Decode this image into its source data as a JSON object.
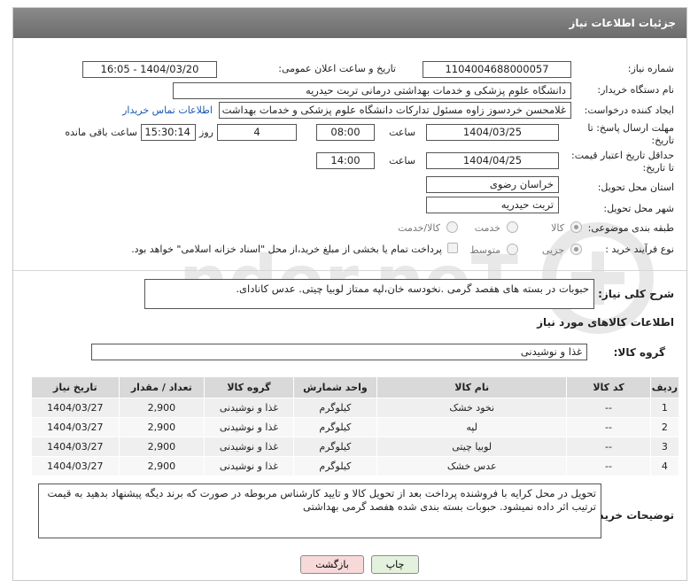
{
  "header": {
    "title": "جزئیات اطلاعات نیاز"
  },
  "fields": {
    "need_number_label": "شماره نیاز:",
    "need_number": "1104004688000057",
    "announce_label": "تاریخ و ساعت اعلان عمومی:",
    "announce_value": "1404/03/20 - 16:05",
    "buyer_org_label": "نام دستگاه خریدار:",
    "buyer_org": "دانشگاه علوم پزشکی و خدمات بهداشتی درمانی تربت حیدریه",
    "requester_label": "ایجاد کننده درخواست:",
    "requester": "غلامحسن خردسوز زاوه مسئول تدارکات دانشگاه علوم پزشکی و خدمات بهداشت",
    "contact_link": "اطلاعات تماس خریدار",
    "deadline_label": "مهلت ارسال پاسخ: تا تاریخ:",
    "deadline_date": "1404/03/25",
    "time_label": "ساعت",
    "deadline_time": "08:00",
    "days_value": "4",
    "days_label": "روز و",
    "remaining_time": "15:30:14",
    "remaining_label": "ساعت باقی مانده",
    "validity_label": "حداقل تاریخ اعتبار قیمت: تا تاریخ:",
    "validity_date": "1404/04/25",
    "validity_time": "14:00",
    "province_label": "استان محل تحویل:",
    "province": "خراسان رضوی",
    "city_label": "شهر محل تحویل:",
    "city": "تربت حیدریه",
    "category_label": "طبقه بندی موضوعی:",
    "cat_goods": "کالا",
    "cat_service": "خدمت",
    "cat_goods_service": "کالا/خدمت",
    "process_label": "نوع فرآیند خرید :",
    "proc_partial": "جزیی",
    "proc_medium": "متوسط",
    "payment_note": "پرداخت تمام یا بخشی از مبلغ خرید،از محل \"اسناد خزانه اسلامی\" خواهد بود.",
    "desc_label": "شرح کلی نیاز:",
    "desc_value": "حبوبات در بسته های هفصد گرمی .نخودسه خان،لپه ممتاز لوبیا چیتی. عدس کانادای.",
    "items_section": "اطلاعات کالاهای مورد نیاز",
    "group_label": "گروه کالا:",
    "group_value": "غذا و نوشیدنی",
    "notes_label": "توضیحات خریدار:",
    "notes_value": "تحویل در محل کرایه با فروشنده پرداخت بعد از تحویل  کالا و تایید کارشناس مربوطه در صورت که برند دیگه پیشنهاد بدهید به قیمت ترتیب اثر داده نمیشود. حبوبات بسته بندی شده هفصد گرمی بهداشتی"
  },
  "table": {
    "headers": [
      "ردیف",
      "کد کالا",
      "نام کالا",
      "واحد شمارش",
      "گروه کالا",
      "تعداد / مقدار",
      "تاریخ نیاز"
    ],
    "rows": [
      [
        "1",
        "--",
        "نخود خشک",
        "کیلوگرم",
        "غذا و نوشیدنی",
        "2,900",
        "1404/03/27"
      ],
      [
        "2",
        "--",
        "لپه",
        "کیلوگرم",
        "غذا و نوشیدنی",
        "2,900",
        "1404/03/27"
      ],
      [
        "3",
        "--",
        "لوبیا چیتی",
        "کیلوگرم",
        "غذا و نوشیدنی",
        "2,900",
        "1404/03/27"
      ],
      [
        "4",
        "--",
        "عدس خشک",
        "کیلوگرم",
        "غذا و نوشیدنی",
        "2,900",
        "1404/03/27"
      ]
    ]
  },
  "buttons": {
    "print": "چاپ",
    "back": "بازگشت"
  },
  "colors": {
    "header": "#7a7a7a",
    "link": "#1a57b5",
    "back_button": "#f7d9d9",
    "print_button": "#e4f1dc"
  },
  "watermark": {
    "text": "AriaTender.neT"
  }
}
